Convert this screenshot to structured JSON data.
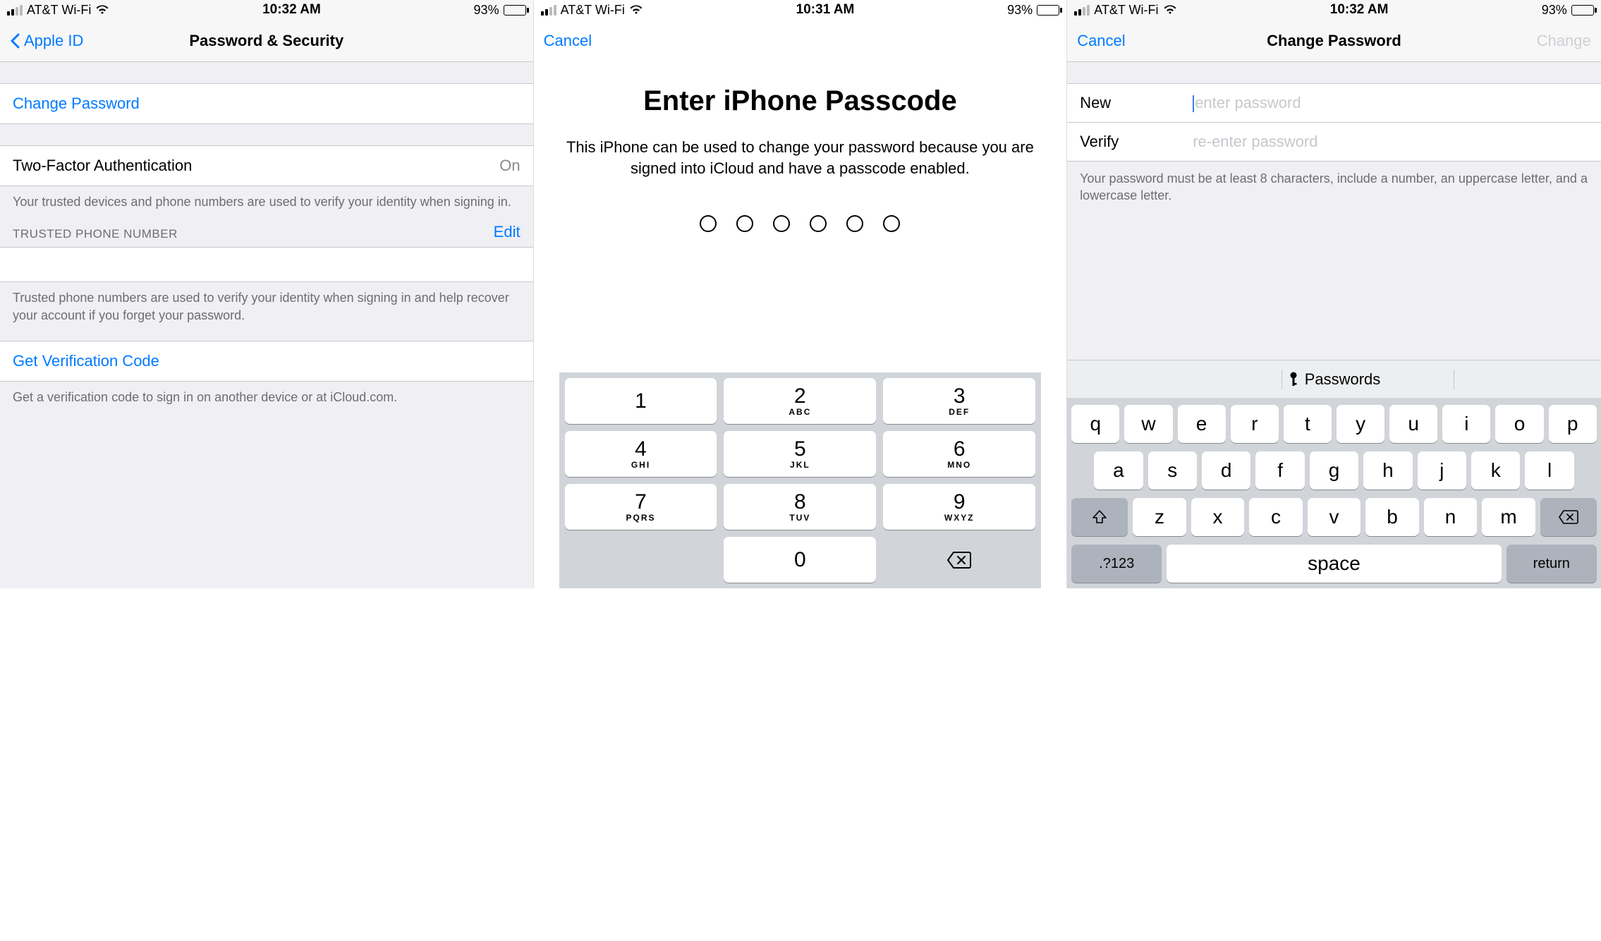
{
  "status": {
    "carrier": "AT&T Wi-Fi",
    "battery_pct": "93%"
  },
  "screen1": {
    "time": "10:32 AM",
    "back_label": "Apple ID",
    "title": "Password & Security",
    "change_password": "Change Password",
    "tfa_label": "Two-Factor Authentication",
    "tfa_value": "On",
    "tfa_footer": "Your trusted devices and phone numbers are used to verify your identity when signing in.",
    "trusted_header": "TRUSTED PHONE NUMBER",
    "edit": "Edit",
    "trusted_footer": "Trusted phone numbers are used to verify your identity when signing in and help recover your account if you forget your password.",
    "get_code": "Get Verification Code",
    "get_code_footer": "Get a verification code to sign in on another device or at iCloud.com."
  },
  "screen2": {
    "time": "10:31 AM",
    "cancel": "Cancel",
    "title": "Enter iPhone Passcode",
    "message": "This iPhone can be used to change your password because you are signed into iCloud and have a passcode enabled.",
    "keys": [
      {
        "n": "1",
        "l": ""
      },
      {
        "n": "2",
        "l": "ABC"
      },
      {
        "n": "3",
        "l": "DEF"
      },
      {
        "n": "4",
        "l": "GHI"
      },
      {
        "n": "5",
        "l": "JKL"
      },
      {
        "n": "6",
        "l": "MNO"
      },
      {
        "n": "7",
        "l": "PQRS"
      },
      {
        "n": "8",
        "l": "TUV"
      },
      {
        "n": "9",
        "l": "WXYZ"
      }
    ],
    "zero": "0"
  },
  "screen3": {
    "time": "10:32 AM",
    "cancel": "Cancel",
    "title": "Change Password",
    "action": "Change",
    "new_label": "New",
    "new_placeholder": "enter password",
    "verify_label": "Verify",
    "verify_placeholder": "re-enter password",
    "requirements": "Your password must be at least 8 characters, include a number, an uppercase letter, and a lowercase letter.",
    "passwords_bar": "Passwords",
    "row1": [
      "q",
      "w",
      "e",
      "r",
      "t",
      "y",
      "u",
      "i",
      "o",
      "p"
    ],
    "row2": [
      "a",
      "s",
      "d",
      "f",
      "g",
      "h",
      "j",
      "k",
      "l"
    ],
    "row3": [
      "z",
      "x",
      "c",
      "v",
      "b",
      "n",
      "m"
    ],
    "numswitch": ".?123",
    "space": "space",
    "return": "return"
  }
}
